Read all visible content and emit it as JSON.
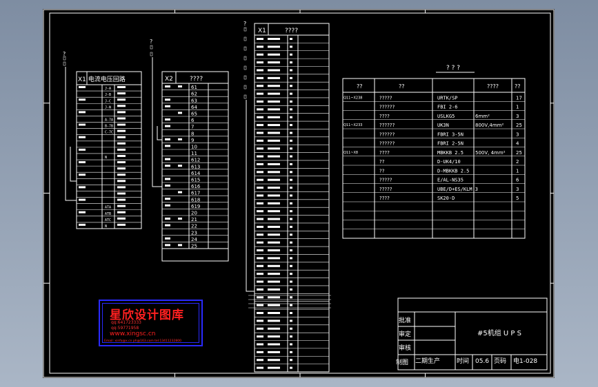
{
  "logo": {
    "name": "星欣设计图库",
    "qq1": "qq:641723333",
    "qq2": "qq:59771958",
    "site": "www.xingsc.cn",
    "mail": "Email: xinfa@x.cn  ph@163.com  tel:13411232800"
  },
  "terminal_x1": {
    "header": "X1 电流电压回路",
    "rows": [
      "J-A",
      "J-B",
      "J-C",
      "J-N",
      "",
      "A-7A",
      "B-7B",
      "C-7C",
      "",
      "",
      "",
      "N",
      "",
      "",
      "",
      "",
      "",
      "",
      "",
      "ATA",
      "ATB",
      "ATC",
      "N"
    ]
  },
  "terminal_x2": {
    "header_id": "X2",
    "header_title": "????",
    "numbers": [
      "61",
      "62",
      "63",
      "64",
      "65",
      "6",
      "7",
      "8",
      "9",
      "10",
      "11",
      "612",
      "613",
      "614",
      "615",
      "616",
      "617",
      "618",
      "619",
      "20",
      "21",
      "22",
      "23",
      "24",
      "25"
    ]
  },
  "terminal_x3": {
    "header_id": "X1",
    "header_title": "????",
    "row_count": 43
  },
  "bom": {
    "title": "? ? ?",
    "headers": [
      "??",
      "??",
      "????",
      "??"
    ],
    "rows": [
      {
        "tag": "Q11~X238",
        "name": "?????",
        "model": "URTK/SP",
        "spec": "",
        "qty": "17"
      },
      {
        "tag": "",
        "name": "??????",
        "model": "FBI 2-6",
        "spec": "",
        "qty": "1"
      },
      {
        "tag": "",
        "name": "????",
        "model": "USLKG5",
        "spec": "6mm²",
        "qty": "3"
      },
      {
        "tag": "Q11~X233",
        "name": "??????",
        "model": "UK3N",
        "spec": "800V,4mm²",
        "qty": "25"
      },
      {
        "tag": "",
        "name": "??????",
        "model": "FBRI 3-5N",
        "spec": "",
        "qty": "3"
      },
      {
        "tag": "",
        "name": "??????",
        "model": "FBRI 2-5N",
        "spec": "",
        "qty": "4"
      },
      {
        "tag": "Q11~X8",
        "name": "????",
        "model": "MBKKB 2.5",
        "spec": "500V, 4mm²",
        "qty": "25"
      },
      {
        "tag": "",
        "name": "??",
        "model": "D-UK4/10",
        "spec": "",
        "qty": "2"
      },
      {
        "tag": "",
        "name": "??",
        "model": "D-MBKKB 2.5",
        "spec": "",
        "qty": "1"
      },
      {
        "tag": "",
        "name": "?????",
        "model": "E/AL-NS35",
        "spec": "",
        "qty": "6"
      },
      {
        "tag": "",
        "name": "?????",
        "model": "UBE/D+ES/KLM 3",
        "spec": "",
        "qty": "3"
      },
      {
        "tag": "",
        "name": "????",
        "model": "SK20-D",
        "spec": "",
        "qty": "5"
      },
      {
        "tag": "",
        "name": "",
        "model": "",
        "spec": "",
        "qty": ""
      },
      {
        "tag": "",
        "name": "",
        "model": "",
        "spec": "",
        "qty": ""
      },
      {
        "tag": "",
        "name": "",
        "model": "",
        "spec": "",
        "qty": ""
      },
      {
        "tag": "",
        "name": "",
        "model": "",
        "spec": "",
        "qty": ""
      }
    ]
  },
  "title_block": {
    "approve": "批准",
    "review": "审定",
    "check": "审核",
    "draw": "制图",
    "drawer": "二期生产",
    "time_label": "时间",
    "time_value": "05.6",
    "page_label": "页码",
    "page_value": "电1-028",
    "project": "#5机组 U P S"
  },
  "markers": [
    "?",
    "?",
    "?"
  ]
}
